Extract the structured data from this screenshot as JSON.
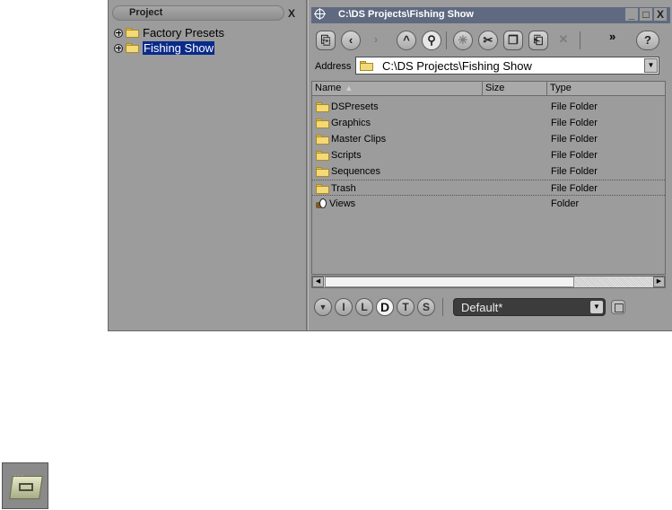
{
  "project_panel": {
    "title": "Project",
    "close_label": "X",
    "tree": [
      {
        "label": "Factory Presets",
        "selected": false
      },
      {
        "label": "Fishing Show",
        "selected": true
      }
    ]
  },
  "explorer": {
    "title": "C:\\DS Projects\\Fishing Show",
    "window_buttons": [
      "_",
      "□",
      "X"
    ],
    "toolbar": {
      "overflow_label": "»",
      "help_label": "?"
    },
    "address_label": "Address",
    "address_value": "C:\\DS Projects\\Fishing Show",
    "columns": {
      "name": "Name",
      "size": "Size",
      "type": "Type"
    },
    "rows": [
      {
        "name": "DSPresets",
        "type": "File Folder",
        "icon": "folder-icon"
      },
      {
        "name": "Graphics",
        "type": "File Folder",
        "icon": "folder-icon"
      },
      {
        "name": "Master Clips",
        "type": "File Folder",
        "icon": "folder-icon"
      },
      {
        "name": "Scripts",
        "type": "File Folder",
        "icon": "folder-icon"
      },
      {
        "name": "Sequences",
        "type": "File Folder",
        "icon": "folder-icon"
      },
      {
        "name": "Trash",
        "type": "File Folder",
        "icon": "folder-icon"
      },
      {
        "name": "Views",
        "type": "Folder",
        "icon": "views-icon"
      }
    ],
    "filter_buttons": [
      "I",
      "L",
      "D",
      "T",
      "S"
    ],
    "active_filter": "D",
    "view_select_value": "Default*"
  },
  "colors": {
    "panel_bg": "#9c9c9c",
    "titlebar": "#5f6a80",
    "selection": "#0a2a8a"
  }
}
